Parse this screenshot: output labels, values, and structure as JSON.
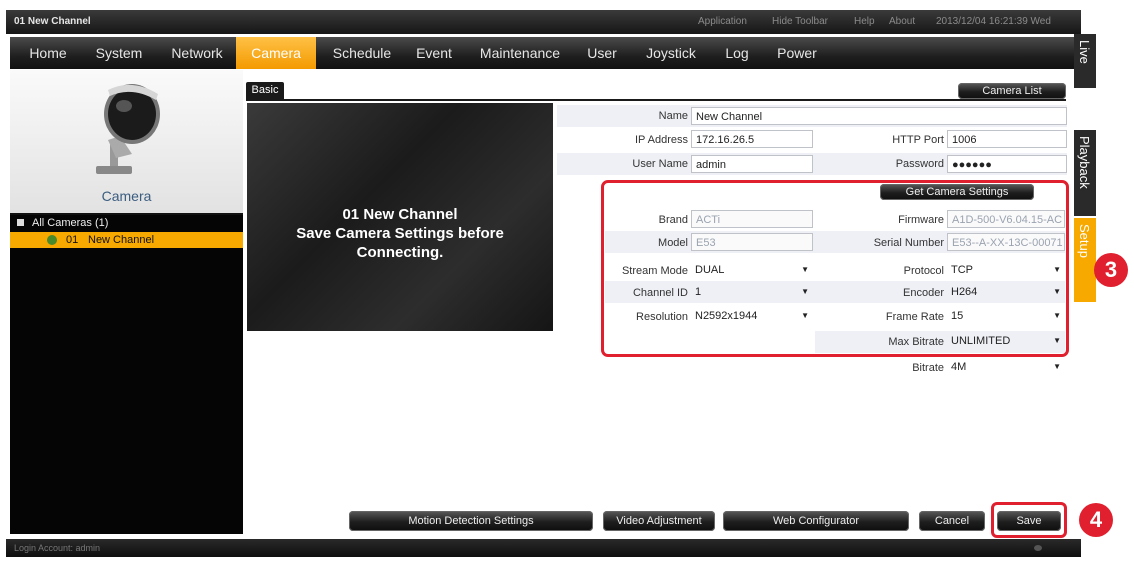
{
  "window": {
    "title": "01 New Channel",
    "toolbar_links": [
      "Application",
      "Hide Toolbar",
      "Help",
      "About"
    ],
    "datetime": "2013/12/04 16:21:39 Wed"
  },
  "menu": {
    "items": [
      "Home",
      "System",
      "Network",
      "Camera",
      "Schedule",
      "Event",
      "Maintenance",
      "User",
      "Joystick",
      "Log",
      "Power"
    ],
    "active": "Camera"
  },
  "side_tabs": [
    "Live",
    "Playback",
    "Setup"
  ],
  "left_panel": {
    "heading": "Camera",
    "tree_root": "All Cameras (1)",
    "tree_item_number": "01",
    "tree_item_name": "New Channel"
  },
  "content": {
    "tab_label": "Basic",
    "camera_list_button": "Camera List",
    "preview_lines": [
      "01 New Channel",
      "Save Camera Settings before",
      "Connecting."
    ],
    "get_settings_button": "Get Camera Settings",
    "fields": {
      "name": {
        "label": "Name",
        "value": "New Channel"
      },
      "ip": {
        "label": "IP Address",
        "value": "172.16.26.5"
      },
      "http_port": {
        "label": "HTTP Port",
        "value": "1006"
      },
      "user": {
        "label": "User Name",
        "value": "admin"
      },
      "password": {
        "label": "Password",
        "value": "●●●●●●"
      },
      "brand": {
        "label": "Brand",
        "value": "ACTi"
      },
      "firmware": {
        "label": "Firmware",
        "value": "A1D-500-V6.04.15-AC"
      },
      "model": {
        "label": "Model",
        "value": "E53"
      },
      "serial": {
        "label": "Serial Number",
        "value": "E53--A-XX-13C-00071"
      },
      "stream_mode": {
        "label": "Stream Mode",
        "value": "DUAL"
      },
      "protocol": {
        "label": "Protocol",
        "value": "TCP"
      },
      "channel_id": {
        "label": "Channel ID",
        "value": "1"
      },
      "encoder": {
        "label": "Encoder",
        "value": "H264"
      },
      "resolution": {
        "label": "Resolution",
        "value": "N2592x1944"
      },
      "frame_rate": {
        "label": "Frame Rate",
        "value": "15"
      },
      "max_bitrate": {
        "label": "Max Bitrate",
        "value": "UNLIMITED"
      },
      "bitrate": {
        "label": "Bitrate",
        "value": "4M"
      }
    },
    "buttons": {
      "motion": "Motion Detection Settings",
      "video": "Video Adjustment",
      "web": "Web Configurator",
      "cancel": "Cancel",
      "save": "Save"
    }
  },
  "annotations": {
    "marker_3": "3",
    "marker_4": "4"
  },
  "status": {
    "login": "Login Account: admin"
  },
  "colors": {
    "accent": "#f5a000",
    "highlight": "#e0202f",
    "dark": "#161616"
  }
}
